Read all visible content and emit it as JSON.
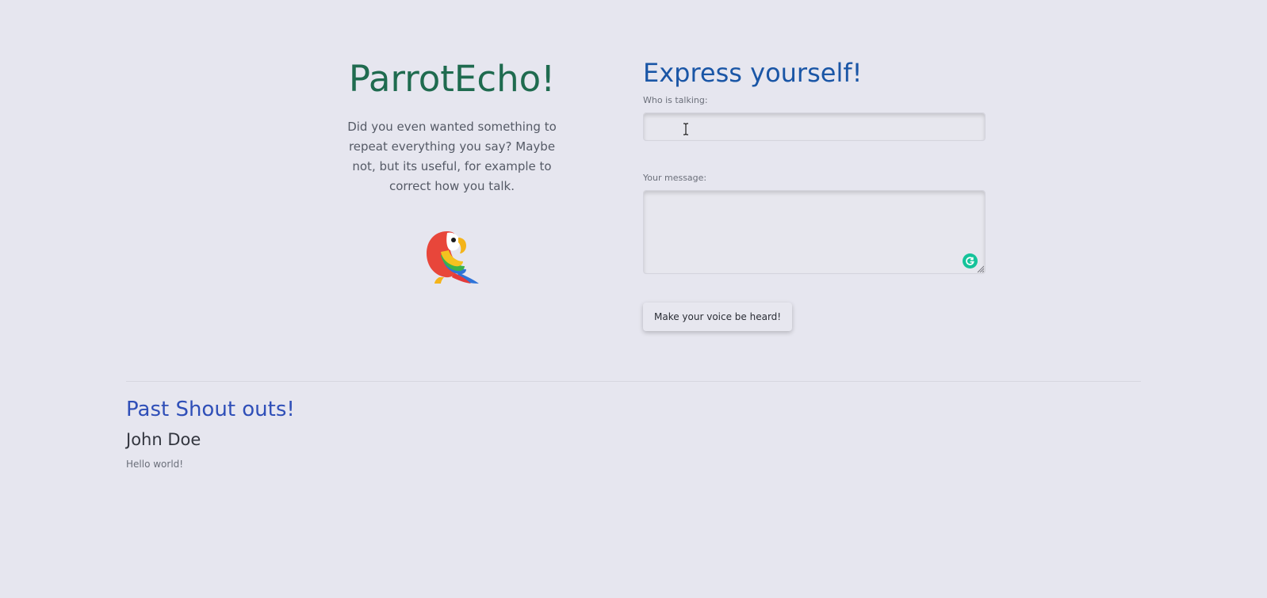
{
  "hero": {
    "title": "ParrotEcho!",
    "description": "Did you even wanted something to repeat everything you say? Maybe not, but its useful, for example to correct how you talk.",
    "image_icon": "parrot-icon"
  },
  "form": {
    "title": "Express yourself!",
    "name_label": "Who is talking:",
    "name_value": "",
    "message_label": "Your message:",
    "message_value": "",
    "submit_label": "Make your voice be heard!",
    "grammarly_icon": "grammarly-icon",
    "resize_icon": "resize-handle-icon",
    "cursor_icon": "text-cursor-icon"
  },
  "past": {
    "title": "Past Shout outs!",
    "shouts": [
      {
        "author": "John Doe",
        "message": "Hello world!"
      }
    ]
  },
  "colors": {
    "background": "#e6e6ef",
    "title_green": "#1f6b4f",
    "title_blue": "#1a56a6",
    "section_blue": "#2f4fb8",
    "grammarly_green": "#15c39a"
  }
}
